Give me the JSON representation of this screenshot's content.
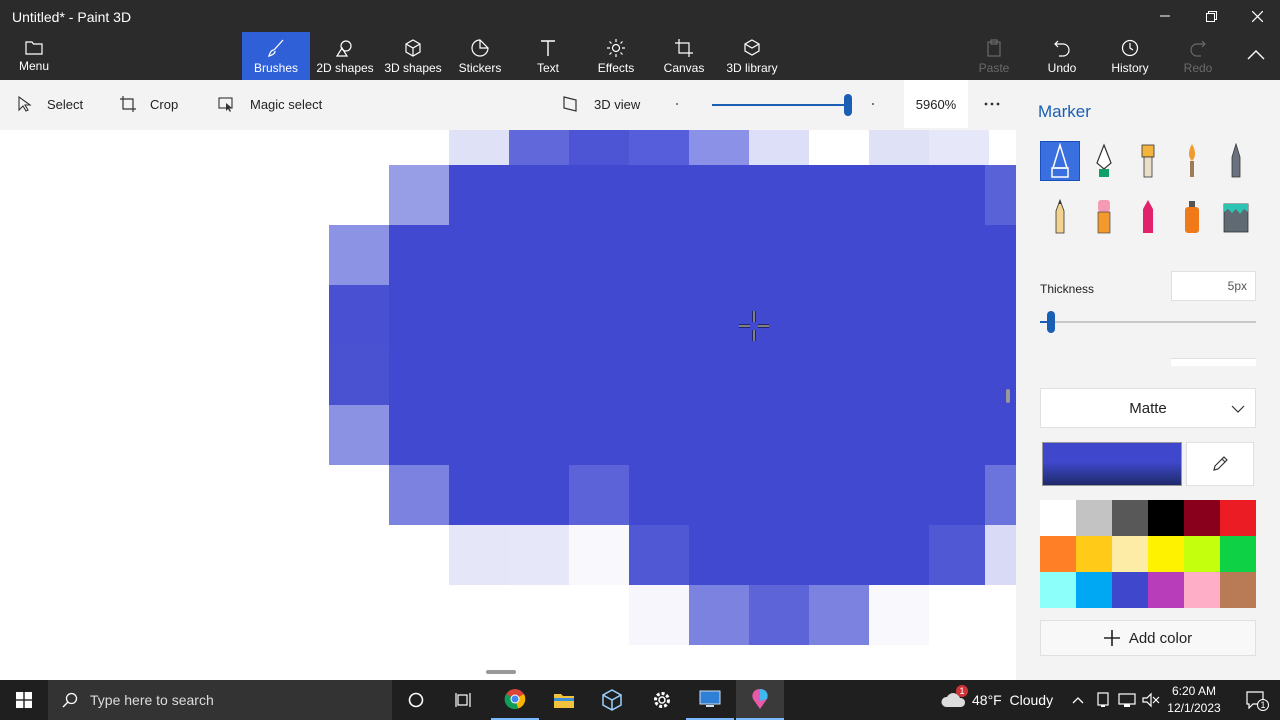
{
  "window": {
    "title": "Untitled* - Paint 3D"
  },
  "ribbon": {
    "menu_label": "Menu",
    "tools": [
      {
        "label": "Brushes",
        "active": true
      },
      {
        "label": "2D shapes"
      },
      {
        "label": "3D shapes"
      },
      {
        "label": "Stickers"
      },
      {
        "label": "Text"
      },
      {
        "label": "Effects"
      },
      {
        "label": "Canvas"
      },
      {
        "label": "3D library"
      }
    ],
    "paste_label": "Paste",
    "undo_label": "Undo",
    "history_label": "History",
    "redo_label": "Redo"
  },
  "toolbar": {
    "select_label": "Select",
    "crop_label": "Crop",
    "magic_select_label": "Magic select",
    "view3d_label": "3D view",
    "zoom_value": "5960%",
    "zoom_fraction": 0.97
  },
  "panel": {
    "title": "Marker",
    "thickness_label": "Thickness",
    "thickness_value": "5px",
    "thickness_fraction": 0.05,
    "finish_value": "Matte",
    "current_color": "#3f48cc",
    "add_color_label": "Add color",
    "palette": [
      "#ffffff",
      "#c3c3c3",
      "#585858",
      "#000000",
      "#88001b",
      "#ec1c24",
      "#ff7f27",
      "#ffca18",
      "#fdeca6",
      "#fff200",
      "#c4ff0e",
      "#0ed145",
      "#8cfffb",
      "#00a8f3",
      "#3f48cc",
      "#b83dba",
      "#ffaec8",
      "#b97a56"
    ]
  },
  "taskbar": {
    "search_placeholder": "Type here to search",
    "weather": "48°F  Cloudy",
    "weather_badge": "1",
    "time": "6:20 AM",
    "date": "12/1/2023",
    "notification_count": "1"
  },
  "colors": {
    "accent": "#3060d8",
    "brand": "#1a5fb4"
  }
}
